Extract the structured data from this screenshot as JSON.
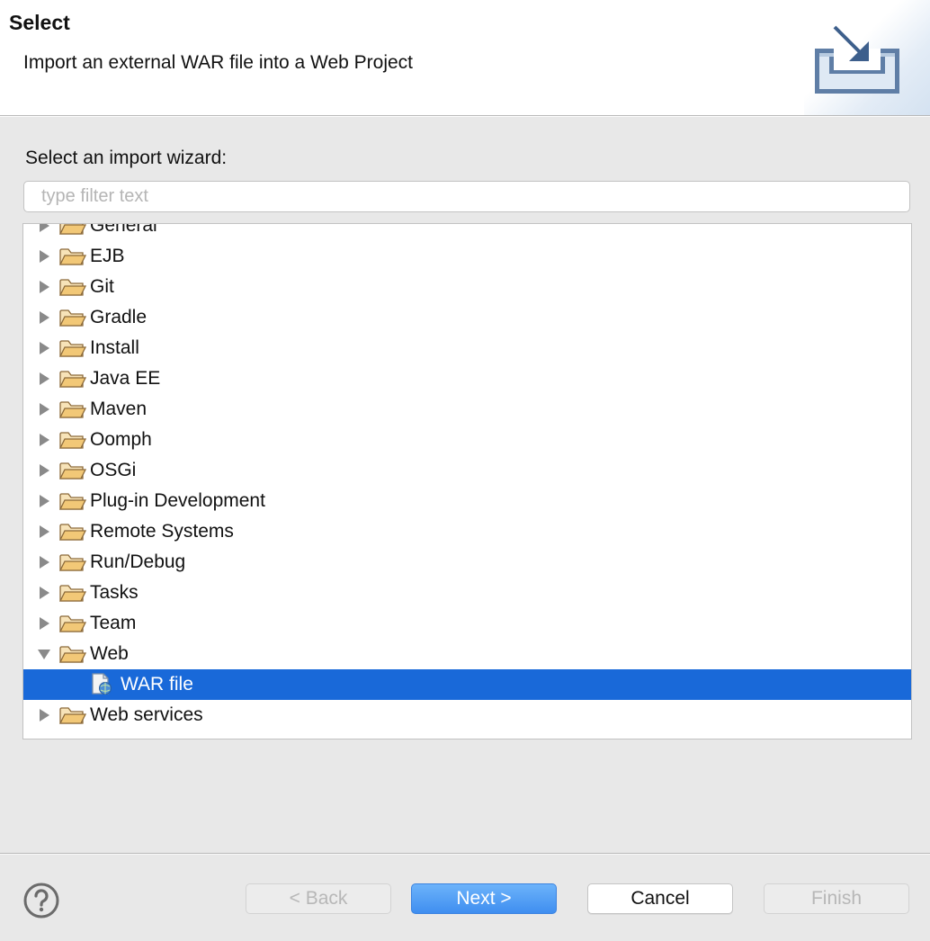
{
  "header": {
    "title": "Select",
    "subtitle": "Import an external WAR file into a Web Project"
  },
  "prompt_label": "Select an import wizard:",
  "filter": {
    "value": "",
    "placeholder": "type filter text"
  },
  "tree": {
    "items": [
      {
        "label": "General",
        "expanded": false,
        "kind": "folder"
      },
      {
        "label": "EJB",
        "expanded": false,
        "kind": "folder"
      },
      {
        "label": "Git",
        "expanded": false,
        "kind": "folder"
      },
      {
        "label": "Gradle",
        "expanded": false,
        "kind": "folder"
      },
      {
        "label": "Install",
        "expanded": false,
        "kind": "folder"
      },
      {
        "label": "Java EE",
        "expanded": false,
        "kind": "folder"
      },
      {
        "label": "Maven",
        "expanded": false,
        "kind": "folder"
      },
      {
        "label": "Oomph",
        "expanded": false,
        "kind": "folder"
      },
      {
        "label": "OSGi",
        "expanded": false,
        "kind": "folder"
      },
      {
        "label": "Plug-in Development",
        "expanded": false,
        "kind": "folder"
      },
      {
        "label": "Remote Systems",
        "expanded": false,
        "kind": "folder"
      },
      {
        "label": "Run/Debug",
        "expanded": false,
        "kind": "folder"
      },
      {
        "label": "Tasks",
        "expanded": false,
        "kind": "folder"
      },
      {
        "label": "Team",
        "expanded": false,
        "kind": "folder"
      },
      {
        "label": "Web",
        "expanded": true,
        "kind": "folder"
      },
      {
        "label": "WAR file",
        "kind": "wizard",
        "selected": true,
        "icon": "war-file-icon"
      },
      {
        "label": "Web services",
        "expanded": false,
        "kind": "folder"
      }
    ]
  },
  "buttons": {
    "back": "< Back",
    "next": "Next >",
    "cancel": "Cancel",
    "finish": "Finish"
  },
  "icons": {
    "help": "help-icon",
    "banner": "import-wizard-banner-icon",
    "folder": "folder-icon",
    "expand": "chevron-right-icon",
    "collapse": "chevron-down-icon"
  },
  "colors": {
    "selection": "#1969d9",
    "default_button": "#3f8ef0",
    "folder": "#e9a545"
  }
}
